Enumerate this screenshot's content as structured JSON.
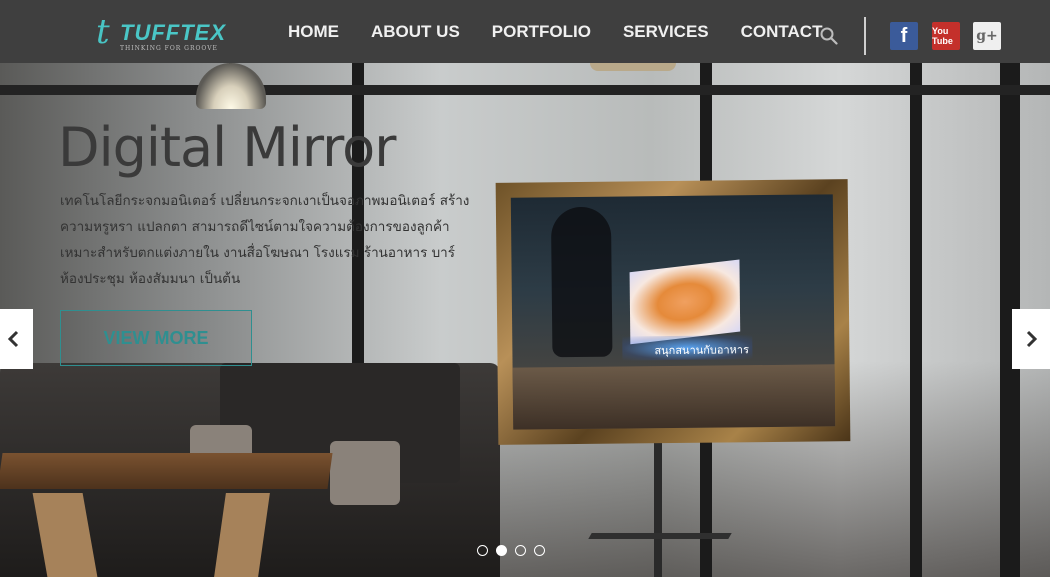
{
  "brand": {
    "name": "TUFFTEX",
    "tagline": "THINKING FOR GROOVE",
    "mark": "t"
  },
  "nav": {
    "items": [
      {
        "label": "HOME"
      },
      {
        "label": "ABOUT US"
      },
      {
        "label": "PORTFOLIO"
      },
      {
        "label": "SERVICES"
      },
      {
        "label": "CONTACT"
      }
    ]
  },
  "header_icons": {
    "search": "search-icon"
  },
  "social": {
    "facebook": {
      "icon": "facebook-icon",
      "glyph": "f",
      "color": "#3b5b9a"
    },
    "youtube": {
      "icon": "youtube-icon",
      "glyph": "You Tube",
      "color": "#c4302b"
    },
    "googleplus": {
      "icon": "google-plus-icon",
      "glyph": "g+",
      "color": "#efefef"
    }
  },
  "slide": {
    "title": "Digital Mirror",
    "description": "เทคโนโลยีกระจกมอนิเตอร์ เปลี่ยนกระจกเงาเป็นจอภาพมอนิเตอร์ สร้างความหรูหรา แปลกตา สามารถดีไซน์ตามใจความต้องการของลูกค้า เหมาะสำหรับตกแต่งภายใน งานสื่อโฆษณา โรงแรม ร้านอาหาร บาร์ ห้องประชุม ห้องสัมมนา เป็นต้น",
    "cta_label": "VIEW MORE",
    "mirror_text": "สนุกสนานกับอาหาร"
  },
  "carousel": {
    "prev_icon": "chevron-left-icon",
    "next_icon": "chevron-right-icon",
    "total_slides": 4,
    "active_slide": 2
  },
  "colors": {
    "topbar": "#3f3f3f",
    "accent": "#2f8f90",
    "logo": "#4ac6c6"
  }
}
